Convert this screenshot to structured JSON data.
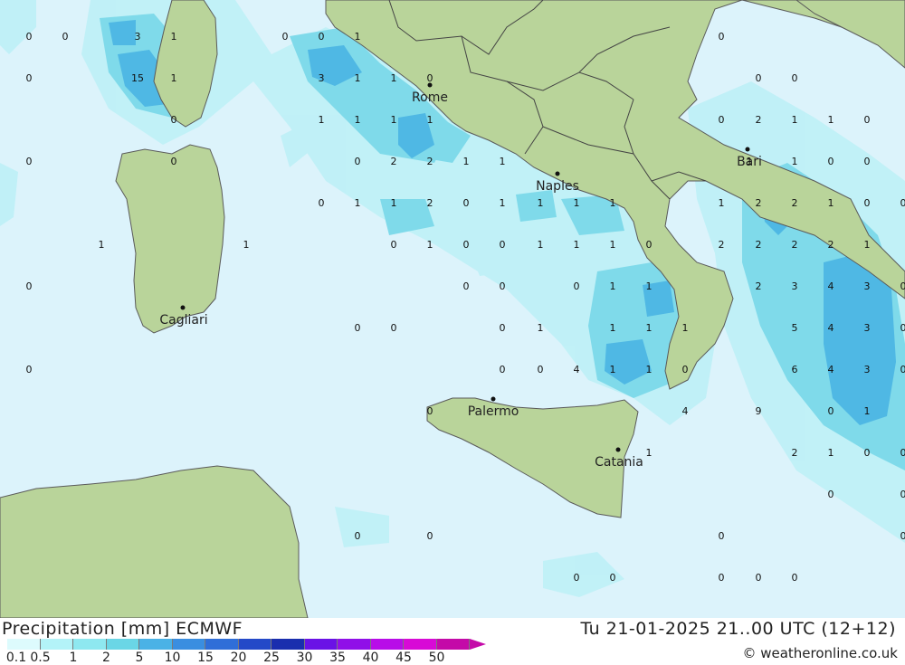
{
  "title": "Precipitation [mm] ECMWF",
  "datetime": "Tu 21-01-2025 21..00 UTC (12+12)",
  "credit": "© weatheronline.co.uk",
  "legend": [
    {
      "label": "0.1",
      "color": "#ddfbfd"
    },
    {
      "label": "0.5",
      "color": "#b3f3f8"
    },
    {
      "label": "1",
      "color": "#8ee8f0"
    },
    {
      "label": "2",
      "color": "#6ad6e6"
    },
    {
      "label": "5",
      "color": "#4ab2e6"
    },
    {
      "label": "10",
      "color": "#3a8ee0"
    },
    {
      "label": "15",
      "color": "#2f6ed8"
    },
    {
      "label": "20",
      "color": "#2449c8"
    },
    {
      "label": "25",
      "color": "#1a2eae"
    },
    {
      "label": "30",
      "color": "#6a12e6"
    },
    {
      "label": "35",
      "color": "#9010e8"
    },
    {
      "label": "40",
      "color": "#b80ce8"
    },
    {
      "label": "45",
      "color": "#d80ad6"
    },
    {
      "label": "50",
      "color": "#c40aa8"
    }
  ],
  "cities": [
    "Rome",
    "Naples",
    "Bari",
    "Cagliari",
    "Palermo",
    "Catania"
  ],
  "values": [
    "0",
    "0",
    "3",
    "1",
    "0",
    "0",
    "1",
    "0",
    "0",
    "15",
    "1",
    "3",
    "1",
    "1",
    "0",
    "0",
    "0",
    "0",
    "1",
    "1",
    "1",
    "1",
    "0",
    "2",
    "1",
    "1",
    "0",
    "0",
    "0",
    "0",
    "2",
    "2",
    "1",
    "1",
    "Bari",
    "1",
    "1",
    "0",
    "0",
    "0",
    "1",
    "1",
    "2",
    "0",
    "1",
    "1",
    "1",
    "1",
    "1",
    "2",
    "2",
    "1",
    "0",
    "0",
    "1",
    "1",
    "0",
    "1",
    "0",
    "0",
    "1",
    "1",
    "1",
    "0",
    "2",
    "2",
    "2",
    "2",
    "1",
    "0",
    "0",
    "0",
    "0",
    "1",
    "1",
    "2",
    "3",
    "4",
    "3",
    "0",
    "0",
    "0",
    "0",
    "1",
    "1",
    "1",
    "1",
    "5",
    "4",
    "3",
    "0",
    "0",
    "0",
    "0",
    "4",
    "1",
    "1",
    "0",
    "6",
    "4",
    "3",
    "0",
    "0",
    "4",
    "9",
    "0",
    "1",
    "1",
    "2",
    "1",
    "0",
    "0",
    "0",
    "0",
    "0",
    "0",
    "0",
    "0",
    "0",
    "0",
    "0",
    "0",
    "0"
  ]
}
